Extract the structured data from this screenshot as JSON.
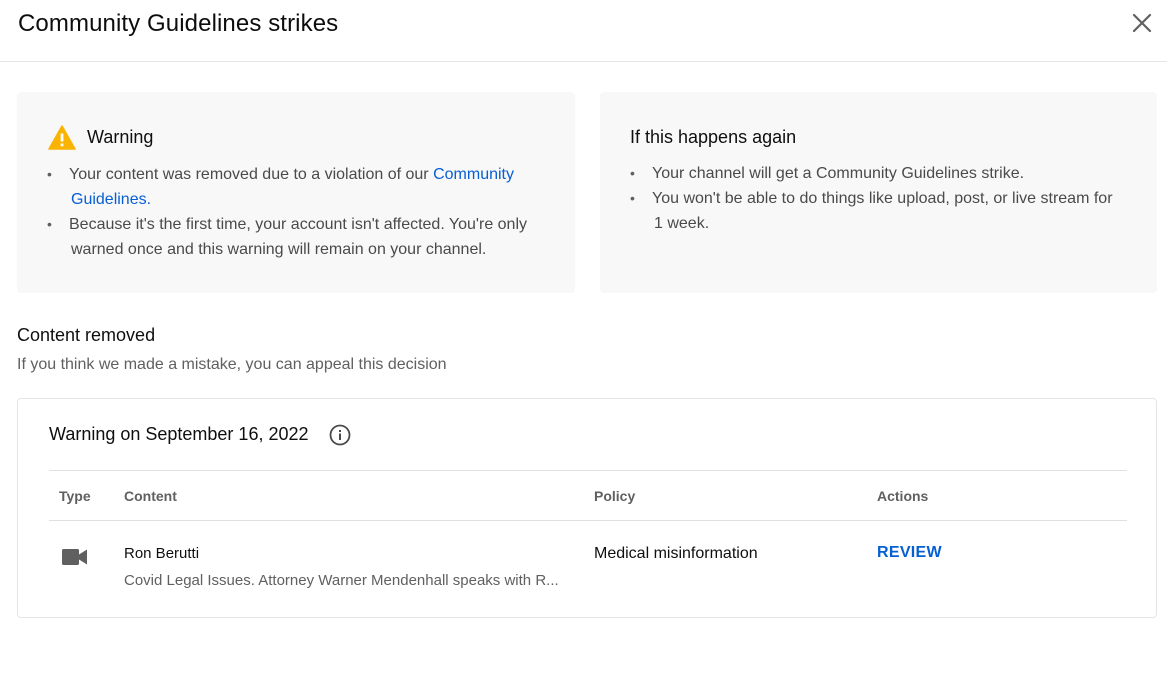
{
  "dialog": {
    "title": "Community Guidelines strikes",
    "close_icon": "close-icon"
  },
  "warning_card": {
    "icon": "warning-icon",
    "icon_color": "#f9b300",
    "title": "Warning",
    "bullet1_text": "Your content was removed due to a violation of our ",
    "bullet1_link": "Community",
    "bullet1_link_line2": "Guidelines",
    "bullet1_end": ".",
    "bullet2_line1": "Because it's the first time, your account isn't affected. You're only",
    "bullet2_line2": "warned once and this warning will remain on your channel."
  },
  "again_card": {
    "title": "If this happens again",
    "bullet1": "Your channel will get a Community Guidelines strike.",
    "bullet2_line1": "You won't be able to do things like upload, post, or live stream for",
    "bullet2_line2": "1 week."
  },
  "content_removed": {
    "title": "Content removed",
    "subtitle": "If you think we made a mistake, you can appeal this decision"
  },
  "strike": {
    "title": "Warning on September 16, 2022",
    "info_icon": "info-icon",
    "columns": [
      "Type",
      "Content",
      "Policy",
      "Actions"
    ],
    "rows": [
      {
        "type_icon": "video-camera-icon",
        "content_title": "Ron Berutti",
        "content_desc": "Covid Legal Issues. Attorney Warner Mendenhall speaks with R...",
        "policy": "Medical misinformation",
        "action": "REVIEW"
      }
    ]
  },
  "colors": {
    "link": "#065fd4",
    "card_bg": "#f8f8f8",
    "warning": "#f9b300"
  }
}
